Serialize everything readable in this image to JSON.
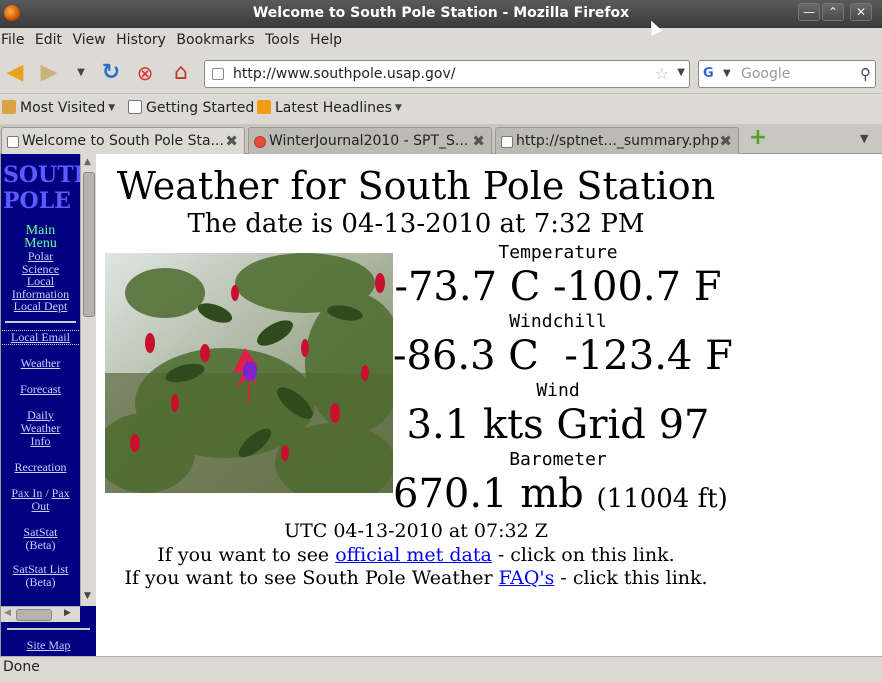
{
  "window": {
    "title": "Welcome to South Pole Station - Mozilla Firefox"
  },
  "menu": [
    "File",
    "Edit",
    "View",
    "History",
    "Bookmarks",
    "Tools",
    "Help"
  ],
  "nav": {
    "url": "http://www.southpole.usap.gov/",
    "search_placeholder": "Google"
  },
  "bookmarks": {
    "most_visited": "Most Visited",
    "getting_started": "Getting Started",
    "latest_headlines": "Latest Headlines"
  },
  "tabs": [
    {
      "label": "Welcome to South Pole Sta...",
      "active": true
    },
    {
      "label": "WinterJournal2010 - SPT_S...",
      "active": false
    },
    {
      "label": "http://sptnet..._summary.php",
      "active": false
    }
  ],
  "sidebar": {
    "title_line1": "SOUTH",
    "title_line2": "POLE",
    "main_menu_line1": "Main",
    "main_menu_line2": "Menu",
    "top_links": [
      "Polar",
      "Science",
      "Local",
      "Information",
      "Local Dept"
    ],
    "local_email": "Local Email",
    "weather": "Weather",
    "forecast": "Forecast",
    "daily_line1": "Daily",
    "daily_line2": "Weather",
    "daily_line3": "Info",
    "recreation": "Recreation",
    "pax_in": "Pax In",
    "pax_sep": "/",
    "pax_out_a": "Pax",
    "pax_out_b": "Out",
    "satstat": "SatStat",
    "satstat_beta": "(Beta)",
    "satstat_list": "SatStat List",
    "satstat_list_beta": "(Beta)",
    "site_map": "Site Map"
  },
  "main": {
    "title": "Weather for South Pole Station",
    "date_line": "The date is 04-13-2010 at 7:32 PM",
    "temperature_label": "Temperature",
    "temperature_value": "-73.7 C -100.7 F",
    "windchill_label": "Windchill",
    "windchill_value": "-86.3 C  -123.4 F",
    "wind_label": "Wind",
    "wind_value": "3.1 kts Grid 97",
    "barometer_label": "Barometer",
    "barometer_value": "670.1 mb",
    "barometer_alt": "(11004 ft)",
    "utc_line": "UTC 04-13-2010 at 07:32 Z",
    "met_prefix": "If you want to see ",
    "met_link": "official met data",
    "met_suffix": " - click on this link.",
    "faq_prefix": "If you want to see South Pole Weather ",
    "faq_link": "FAQ's",
    "faq_suffix": " - click this link."
  },
  "status": {
    "text": "Done"
  }
}
